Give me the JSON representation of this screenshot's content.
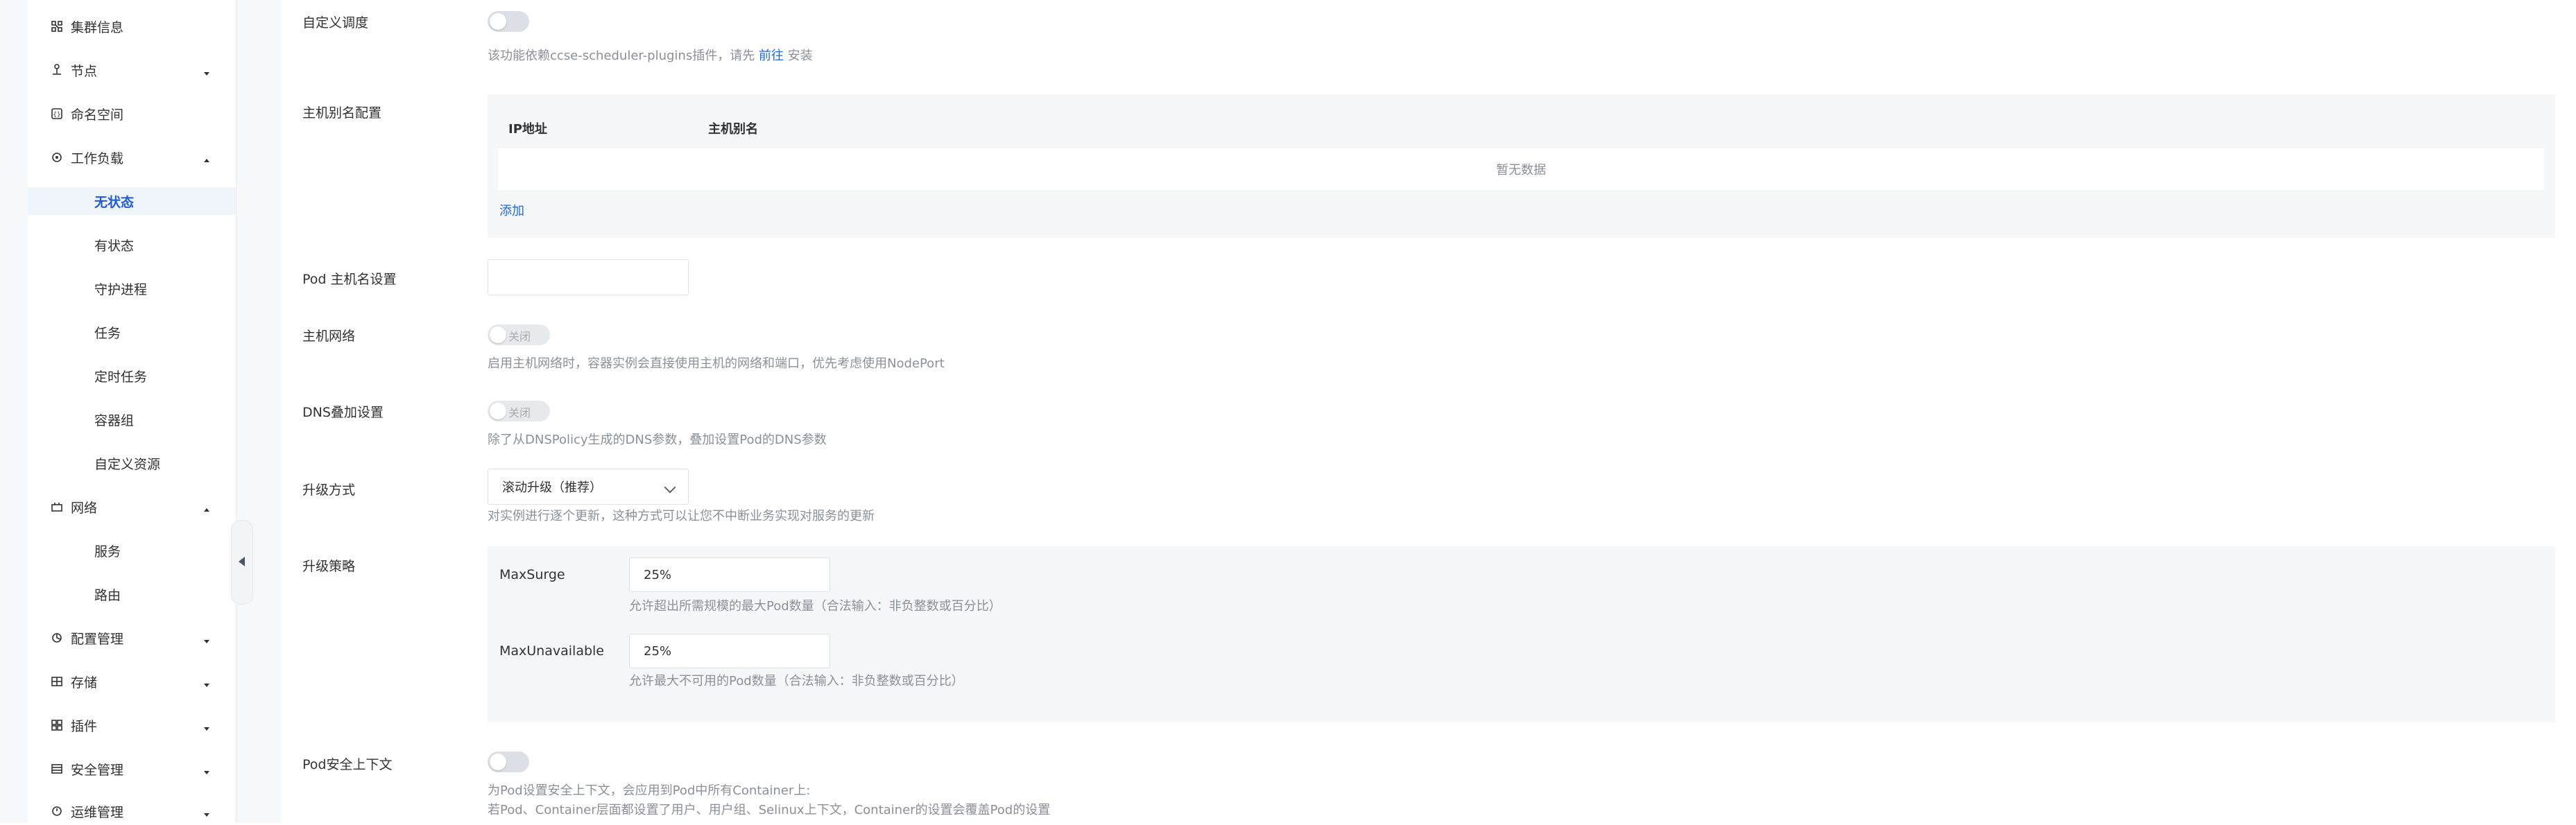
{
  "sidebar": {
    "items": [
      {
        "label": "集群信息",
        "icon": "cluster-icon",
        "caret": ""
      },
      {
        "label": "节点",
        "icon": "node-icon",
        "caret": "down"
      },
      {
        "label": "命名空间",
        "icon": "namespace-icon",
        "caret": ""
      },
      {
        "label": "工作负载",
        "icon": "workload-icon",
        "caret": "up"
      },
      {
        "label": "网络",
        "icon": "network-icon",
        "caret": "up"
      },
      {
        "label": "配置管理",
        "icon": "config-icon",
        "caret": "down"
      },
      {
        "label": "存储",
        "icon": "storage-icon",
        "caret": "down"
      },
      {
        "label": "插件",
        "icon": "plugin-icon",
        "caret": "down"
      },
      {
        "label": "安全管理",
        "icon": "security-icon",
        "caret": "down"
      },
      {
        "label": "运维管理",
        "icon": "ops-icon",
        "caret": "down"
      }
    ],
    "workload_children": [
      "无状态",
      "有状态",
      "守护进程",
      "任务",
      "定时任务",
      "容器组",
      "自定义资源"
    ],
    "active_child": "无状态",
    "network_children": [
      "服务",
      "路由"
    ]
  },
  "form": {
    "custom_schedule": {
      "label": "自定义调度",
      "hint_prefix": "该功能依赖ccse-scheduler-plugins插件，请先 ",
      "hint_link": "前往",
      "hint_suffix": " 安装"
    },
    "host_alias": {
      "label": "主机别名配置",
      "col_ip": "IP地址",
      "col_alias": "主机别名",
      "empty": "暂无数据",
      "add": "添加"
    },
    "pod_hostname": {
      "label": "Pod 主机名设置",
      "value": ""
    },
    "host_network": {
      "label": "主机网络",
      "toggle_text": "关闭",
      "hint": "启用主机网络时，容器实例会直接使用主机的网络和端口，优先考虑使用NodePort"
    },
    "dns": {
      "label": "DNS叠加设置",
      "toggle_text": "关闭",
      "hint": "除了从DNSPolicy生成的DNS参数，叠加设置Pod的DNS参数"
    },
    "upgrade_method": {
      "label": "升级方式",
      "value": "滚动升级（推荐）",
      "hint": "对实例进行逐个更新，这种方式可以让您不中断业务实现对服务的更新"
    },
    "upgrade_strategy": {
      "label": "升级策略",
      "max_surge_label": "MaxSurge",
      "max_surge_value": "25%",
      "max_surge_hint": "允许超出所需规模的最大Pod数量（合法输入：非负整数或百分比）",
      "max_unavailable_label": "MaxUnavailable",
      "max_unavailable_value": "25%",
      "max_unavailable_hint": "允许最大不可用的Pod数量（合法输入：非负整数或百分比）"
    },
    "pod_security": {
      "label": "Pod安全上下文",
      "hint1": "为Pod设置安全上下文，会应用到Pod中所有Container上:",
      "hint2": "若Pod、Container层面都设置了用户、用户组、Selinux上下文，Container的设置会覆盖Pod的设置"
    }
  }
}
